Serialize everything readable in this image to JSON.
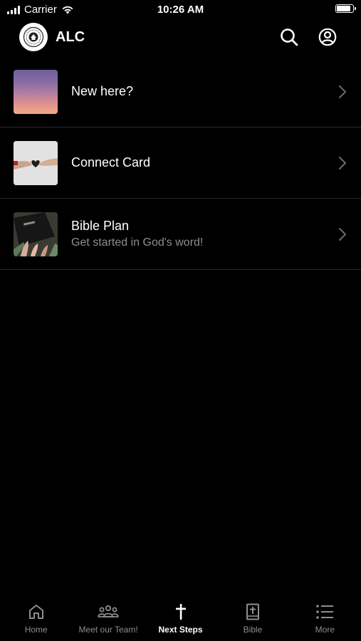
{
  "status_bar": {
    "carrier": "Carrier",
    "time": "10:26 AM",
    "battery_level": 0.95
  },
  "header": {
    "title": "ALC",
    "icons": [
      "church-logo-icon",
      "search-icon",
      "account-icon"
    ]
  },
  "list": {
    "items": [
      {
        "title": "New here?",
        "subtitle": "",
        "thumb": "sunset-thumbnail"
      },
      {
        "title": "Connect Card",
        "subtitle": "",
        "thumb": "hands-heart-thumbnail"
      },
      {
        "title": "Bible Plan",
        "subtitle": "Get started in God's word!",
        "thumb": "bible-flowers-thumbnail"
      }
    ]
  },
  "tabbar": {
    "tabs": [
      {
        "label": "Home",
        "icon": "home-icon",
        "active": false
      },
      {
        "label": "Meet our Team!",
        "icon": "group-icon",
        "active": false
      },
      {
        "label": "Next Steps",
        "icon": "cross-icon",
        "active": true
      },
      {
        "label": "Bible",
        "icon": "bible-icon",
        "active": false
      },
      {
        "label": "More",
        "icon": "list-icon",
        "active": false
      }
    ]
  },
  "colors": {
    "background": "#000000",
    "text": "#ffffff",
    "secondary_text": "#8e8e93",
    "divider": "#2b2b2b"
  }
}
